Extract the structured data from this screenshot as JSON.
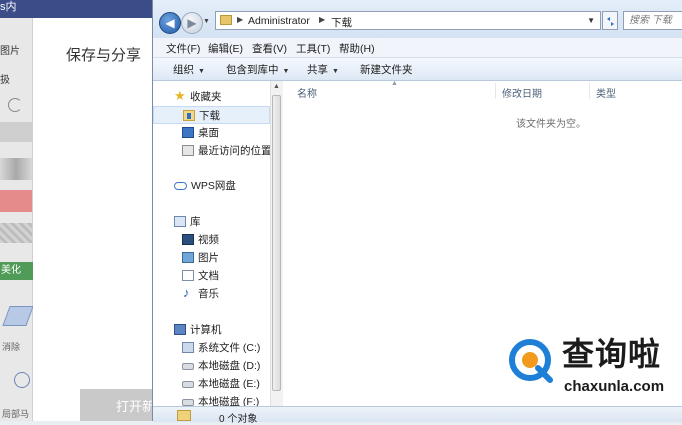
{
  "background_app": {
    "window_title_fragment": "s内",
    "tab_pictures": "图片",
    "tab_fragment": "扱",
    "section_title": "保存与分享",
    "beauty_tab": "美化",
    "tool_label_1": "消除",
    "tool_label_2": "局部马",
    "open_button": "打开新"
  },
  "explorer": {
    "address": {
      "crumbs": [
        "Administrator",
        "下载"
      ]
    },
    "search": {
      "placeholder": "搜索 下载"
    },
    "menu": [
      "文件(F)",
      "编辑(E)",
      "查看(V)",
      "工具(T)",
      "帮助(H)"
    ],
    "commands": [
      "组织",
      "包含到库中",
      "共享",
      "新建文件夹"
    ],
    "nav": {
      "favorites": "收藏夹",
      "download": "下载",
      "desktop": "桌面",
      "recent": "最近访问的位置",
      "wps": "WPS网盘",
      "library": "库",
      "videos": "视频",
      "pictures": "图片",
      "documents": "文档",
      "music": "音乐",
      "computer": "计算机",
      "drive_c": "系统文件 (C:)",
      "drive_d": "本地磁盘 (D:)",
      "drive_e": "本地磁盘 (E:)",
      "drive_f": "本地磁盘 (F:)"
    },
    "columns": [
      "名称",
      "修改日期",
      "类型"
    ],
    "empty_message": "该文件夹为空。",
    "status": "0 个对象"
  },
  "watermark": {
    "brand": "查询啦",
    "url": "chaxunla.com"
  },
  "colors": {
    "titlebar": "#3b4d88",
    "selection": "#e6f0fb",
    "beauty_tab": "#4f9b57",
    "watermark_ring": "#1e7fd6",
    "watermark_accent": "#f39a1e"
  }
}
